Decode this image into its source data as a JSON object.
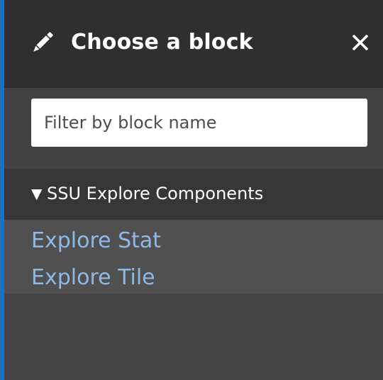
{
  "dialog": {
    "title": "Choose a block",
    "header_icon": "pencil-icon",
    "close_icon": "close-icon"
  },
  "filter": {
    "placeholder": "Filter by block name",
    "value": ""
  },
  "categories": [
    {
      "expanded_marker": "▼",
      "label": "SSU Explore Components",
      "blocks": [
        {
          "label": "Explore Stat"
        },
        {
          "label": "Explore Tile"
        }
      ]
    }
  ],
  "colors": {
    "header_bg": "#2f2f2f",
    "panel_bg": "#444444",
    "category_bg": "#363636",
    "link": "#8fb8e6",
    "accent_edge": "#1f6fc1"
  }
}
